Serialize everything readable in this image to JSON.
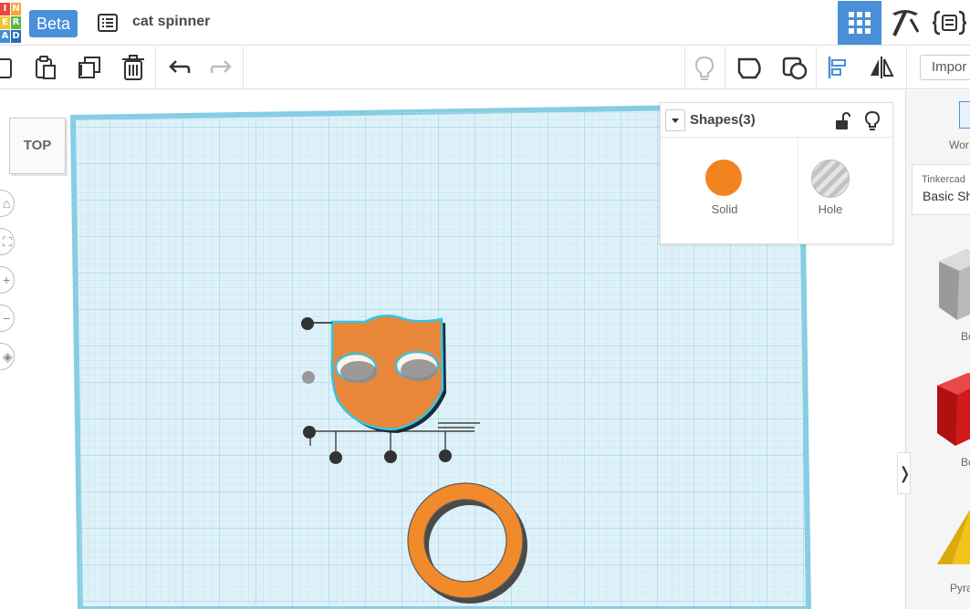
{
  "header": {
    "logo_letters": [
      "T",
      "I",
      "N",
      "K",
      "E",
      "R",
      "C",
      "A",
      "D"
    ],
    "beta_label": "Beta",
    "project_title": "cat spinner"
  },
  "toolbar": {
    "import_label": "Impor"
  },
  "workplane": {
    "view_cube_label": "TOP"
  },
  "shapes_panel": {
    "title": "Shapes(3)",
    "solid_label": "Solid",
    "hole_label": "Hole",
    "solid_color": "#f3831f"
  },
  "library": {
    "work_label": "Wor",
    "category_small": "Tinkercad",
    "category_main": "Basic Sh",
    "items": [
      "Bo",
      "Bo",
      "Pyra"
    ]
  },
  "colors": {
    "accent": "#4a90d9",
    "grid": "#a9dcec",
    "shape_orange": "#f3831f",
    "selection_outline": "#31c6e8"
  }
}
